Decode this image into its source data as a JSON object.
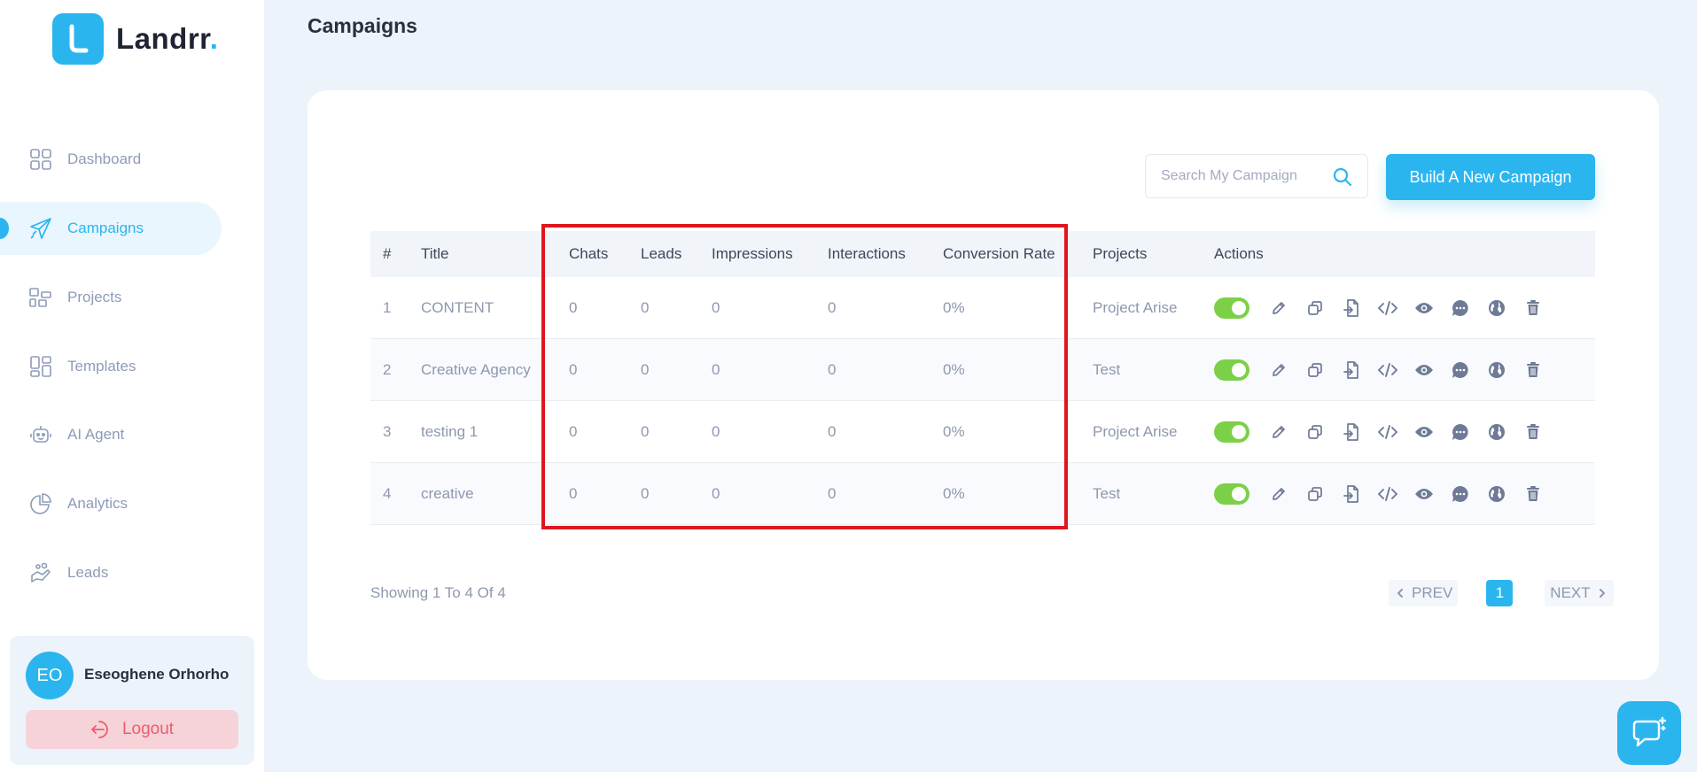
{
  "app": {
    "brand": "Landrr",
    "brand_dot": "."
  },
  "sidebar": {
    "items": [
      {
        "label": "Dashboard",
        "icon": "grid-icon",
        "active": false
      },
      {
        "label": "Campaigns",
        "icon": "paper-plane-icon",
        "active": true
      },
      {
        "label": "Projects",
        "icon": "projects-icon",
        "active": false
      },
      {
        "label": "Templates",
        "icon": "templates-icon",
        "active": false
      },
      {
        "label": "AI Agent",
        "icon": "robot-icon",
        "active": false
      },
      {
        "label": "Analytics",
        "icon": "pie-chart-icon",
        "active": false
      },
      {
        "label": "Leads",
        "icon": "hand-icon",
        "active": false
      }
    ],
    "user": {
      "initials": "EO",
      "name": "Eseoghene Orhorho"
    },
    "logout_label": "Logout"
  },
  "page": {
    "title": "Campaigns"
  },
  "search": {
    "placeholder": "Search My Campaign",
    "value": ""
  },
  "build_button_label": "Build A New Campaign",
  "table": {
    "headers": [
      "#",
      "Title",
      "Chats",
      "Leads",
      "Impressions",
      "Interactions",
      "Conversion Rate",
      "Projects",
      "Actions"
    ],
    "rows": [
      {
        "num": "1",
        "title": "CONTENT",
        "chats": "0",
        "leads": "0",
        "impressions": "0",
        "interactions": "0",
        "conversion": "0%",
        "project": "Project Arise",
        "enabled": true
      },
      {
        "num": "2",
        "title": "Creative Agency",
        "chats": "0",
        "leads": "0",
        "impressions": "0",
        "interactions": "0",
        "conversion": "0%",
        "project": "Test",
        "enabled": true
      },
      {
        "num": "3",
        "title": "testing 1",
        "chats": "0",
        "leads": "0",
        "impressions": "0",
        "interactions": "0",
        "conversion": "0%",
        "project": "Project Arise",
        "enabled": true
      },
      {
        "num": "4",
        "title": "creative",
        "chats": "0",
        "leads": "0",
        "impressions": "0",
        "interactions": "0",
        "conversion": "0%",
        "project": "Test",
        "enabled": true
      }
    ],
    "action_icons": [
      "pencil-icon",
      "copy-icon",
      "file-import-icon",
      "code-icon",
      "eye-icon",
      "chat-icon",
      "globe-icon",
      "trash-icon"
    ]
  },
  "pagination": {
    "summary": "Showing 1 To 4 Of 4",
    "prev": "PREV",
    "current": "1",
    "next": "NEXT"
  },
  "colors": {
    "accent": "#2bb5ef",
    "toggle_on": "#7bd048",
    "highlight": "#e0151e",
    "logout": "#ef5b6e"
  }
}
